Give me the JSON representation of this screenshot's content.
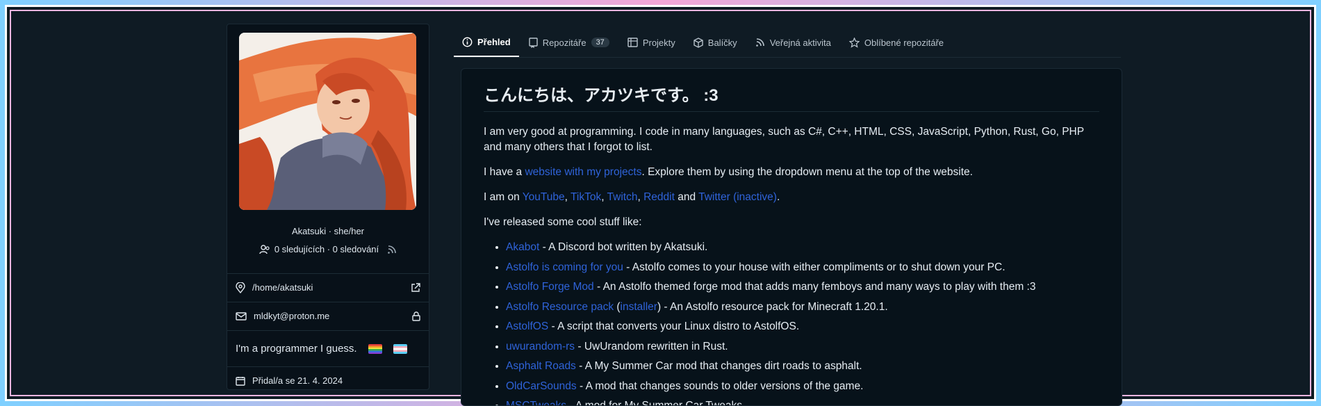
{
  "sidebar": {
    "name_line": "Akatsuki · she/her",
    "follow_line": "0 sledujících · 0 sledování",
    "location": "/home/akatsuki",
    "email": "mldkyt@proton.me",
    "bio": "I'm a programmer I guess.",
    "joined": "Přidal/a se 21. 4. 2024"
  },
  "tabs": [
    {
      "label": "Přehled",
      "icon": "info-icon",
      "active": true
    },
    {
      "label": "Repozitáře",
      "icon": "repo-icon",
      "count": "37"
    },
    {
      "label": "Projekty",
      "icon": "project-icon"
    },
    {
      "label": "Balíčky",
      "icon": "package-icon"
    },
    {
      "label": "Veřejná aktivita",
      "icon": "rss-icon"
    },
    {
      "label": "Oblíbené repozitáře",
      "icon": "star-icon"
    }
  ],
  "readme": {
    "title": "こんにちは、アカツキです。 :3",
    "p1": "I am very good at programming. I code in many languages, such as C#, C++, HTML, CSS, JavaScript, Python, Rust, Go, PHP and many others that I forgot to list.",
    "p2_pre": "I have a ",
    "p2_link": "website with my projects",
    "p2_post": ". Explore them by using the dropdown menu at the top of the website.",
    "p3_pre": "I am on ",
    "links_social": [
      "YouTube",
      "TikTok",
      "Twitch",
      "Reddit",
      "Twitter (inactive)"
    ],
    "p3_and": " and ",
    "p4": "I've released some cool stuff like:",
    "items": [
      {
        "link": "Akabot",
        "text": " - A Discord bot written by Akatsuki."
      },
      {
        "link": "Astolfo is coming for you",
        "text": " - Astolfo comes to your house with either compliments or to shut down your PC."
      },
      {
        "link": "Astolfo Forge Mod",
        "text": " - An Astolfo themed forge mod that adds many femboys and many ways to play with them :3"
      },
      {
        "link": "Astolfo Resource pack",
        "link2": "installer",
        "text": ") - An Astolfo resource pack for Minecraft 1.20.1."
      },
      {
        "link": "AstolfOS",
        "text": " - A script that converts your Linux distro to AstolfOS."
      },
      {
        "link": "uwurandom-rs",
        "text": " - UwUrandom rewritten in Rust."
      },
      {
        "link": "Asphalt Roads",
        "text": " - A My Summer Car mod that changes dirt roads to asphalt."
      },
      {
        "link": "OldCarSounds",
        "text": " - A mod that changes sounds to older versions of the game."
      },
      {
        "link": "MSCTweaks",
        "text": " - A mod for My Summer Car Tweaks"
      }
    ]
  },
  "colors": {
    "link": "#2f63d9",
    "bg": "#0f1b24",
    "border_pink": "#f7b6e0",
    "border_blue": "#7fd0ff"
  }
}
